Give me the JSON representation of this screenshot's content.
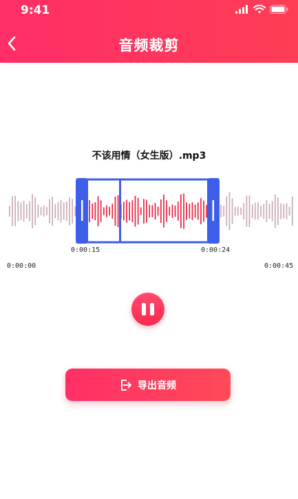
{
  "status_bar": {
    "time": "9:41"
  },
  "header": {
    "title": "音频裁剪"
  },
  "track": {
    "filename": "不该用情（女生版）.mp3"
  },
  "timeline": {
    "selection_start": "0:00:15",
    "selection_end": "0:00:24",
    "total_start": "0:00:00",
    "total_end": "0:00:45"
  },
  "player": {
    "state": "playing"
  },
  "actions": {
    "export_label": "导出音频"
  },
  "colors": {
    "accent": "#ff3359",
    "selection": "#3c5ee8",
    "wave_active": "#e8203f",
    "wave_inactive": "#c9aab3"
  },
  "icons": {
    "back": "chevron-left-icon",
    "pause": "pause-icon",
    "export": "export-icon",
    "signal": "signal-icon",
    "wifi": "wifi-icon",
    "battery": "battery-icon"
  }
}
